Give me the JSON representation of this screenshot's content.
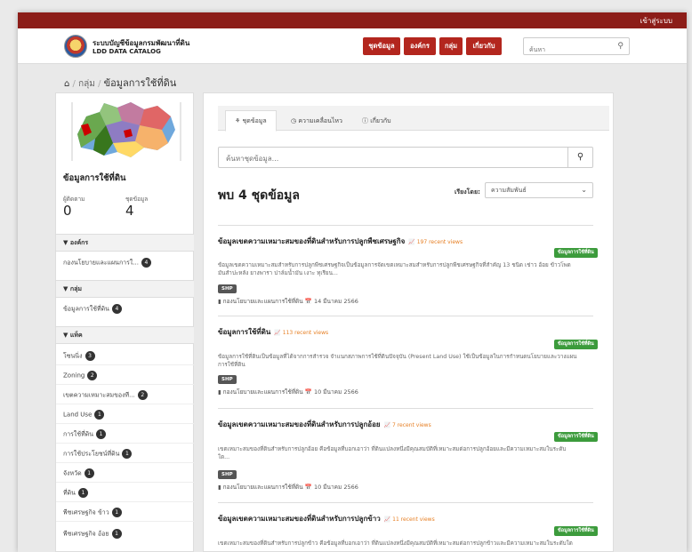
{
  "topbar": {
    "login": "เข้าสู่ระบบ"
  },
  "brand": {
    "title": "ระบบบัญชีข้อมูลกรมพัฒนาที่ดิน",
    "subtitle": "LDD DATA CATALOG"
  },
  "nav": {
    "datasets": "ชุดข้อมูล",
    "organizations": "องค์กร",
    "groups": "กลุ่ม",
    "about": "เกี่ยวกับ"
  },
  "search": {
    "placeholder": "ค้นหา"
  },
  "breadcrumb": {
    "group": "กลุ่ม",
    "current": "ข้อมูลการใช้ที่ดิน"
  },
  "sidebar": {
    "title": "ข้อมูลการใช้ที่ดิน",
    "followers_label": "ผู้ติดตาม",
    "followers": "0",
    "datasets_label": "ชุดข้อมูล",
    "datasets": "4",
    "org_header": "องค์กร",
    "orgs": [
      {
        "label": "กองนโยบายและแผนการใ...",
        "count": "4"
      }
    ],
    "group_header": "กลุ่ม",
    "groups": [
      {
        "label": "ข้อมูลการใช้ที่ดิน",
        "count": "4"
      }
    ],
    "tag_header": "แท็ค",
    "tags": [
      {
        "label": "โซนนิ่ง",
        "count": "3"
      },
      {
        "label": "Zoning",
        "count": "2"
      },
      {
        "label": "เขตความเหมาะสมของที...",
        "count": "2"
      },
      {
        "label": "Land Use",
        "count": "1"
      },
      {
        "label": "การใช้ที่ดิน",
        "count": "1"
      },
      {
        "label": "การใช้ประโยชน์ที่ดิน",
        "count": "1"
      },
      {
        "label": "จังหวัด",
        "count": "1"
      },
      {
        "label": "ที่ดิน",
        "count": "1"
      },
      {
        "label": "พืชเศรษฐกิจ ข้าว",
        "count": "1"
      },
      {
        "label": "พืชเศรษฐกิจ อ้อย",
        "count": "1"
      }
    ]
  },
  "tabs": {
    "datasets": "ชุดข้อมูล",
    "activity": "ความเคลื่อนไหว",
    "about": "เกี่ยวกับ"
  },
  "main": {
    "search_placeholder": "ค้นหาชุดข้อมูล...",
    "found": "พบ 4 ชุดข้อมูล",
    "sort_label": "เรียงโดย:",
    "sort_value": "ความสัมพันธ์"
  },
  "datasets": [
    {
      "title": "ข้อมูลเขตความเหมาะสมของที่ดินสำหรับการปลูกพืชเศรษฐกิจ",
      "views": "197 recent views",
      "tag": "ข้อมูลการใช้ที่ดิน",
      "desc": "ข้อมูลเขตความเหมาะสมสำหรับการปลูกพืชเศรษฐกิจเป็นข้อมูลการจัดเขตเหมาะสมสำหรับการปลูกพืชเศรษฐกิจที่สำคัญ 13 ชนิด เช่าว อ้อย ข้าวโพด มันสำปะหลัง ยางพารา ปาล์มน้ำมัน เงาะ ทุเรียน...",
      "format": "SHP",
      "meta": "กองนโยบายและแผนการใช้ที่ดิน 📅 14 มีนาคม 2566"
    },
    {
      "title": "ข้อมูลการใช้ที่ดิน",
      "views": "113 recent views",
      "tag": "ข้อมูลการใช้ที่ดิน",
      "desc": "ข้อมูลการใช้ที่ดินเป็นข้อมูลที่ได้จากการสำรวจ จำแนกสภาพการใช้ที่ดินปัจจุบัน (Present Land Use) ใช้เป็นข้อมูลในการกำหนดนโยบายและวางแผนการใช้ที่ดิน",
      "format": "SHP",
      "meta": "กองนโยบายและแผนการใช้ที่ดิน 📅 10 มีนาคม 2566"
    },
    {
      "title": "ข้อมูลเขตความเหมาะสมของที่ดินสำหรับการปลูกอ้อย",
      "views": "7 recent views",
      "tag": "ข้อมูลการใช้ที่ดิน",
      "desc": "เขตเหมาะสมของที่ดินสำหรับการปลูกอ้อย คือข้อมูลที่บอกเอาว่า ที่ดินแปลงหนึ่งมีคุณสมบัติที่เหมาะสมต่อการปลูกอ้อยและมีความเหมาะสมในระดับใด...",
      "format": "SHP",
      "meta": "กองนโยบายและแผนการใช้ที่ดิน 📅 10 มีนาคม 2566"
    },
    {
      "title": "ข้อมูลเขตความเหมาะสมของที่ดินสำหรับการปลูกข้าว",
      "views": "11 recent views",
      "tag": "ข้อมูลการใช้ที่ดิน",
      "desc": "เขตเหมาะสมของที่ดินสำหรับการปลูกข้าว คือข้อมูลที่บอกเอาว่า ที่ดินแปลงหนึ่งมีคุณสมบัติที่เหมาะสมต่อการปลูกข้าวและมีความเหมาะสมในระดับใด",
      "format": "",
      "meta": ""
    }
  ]
}
